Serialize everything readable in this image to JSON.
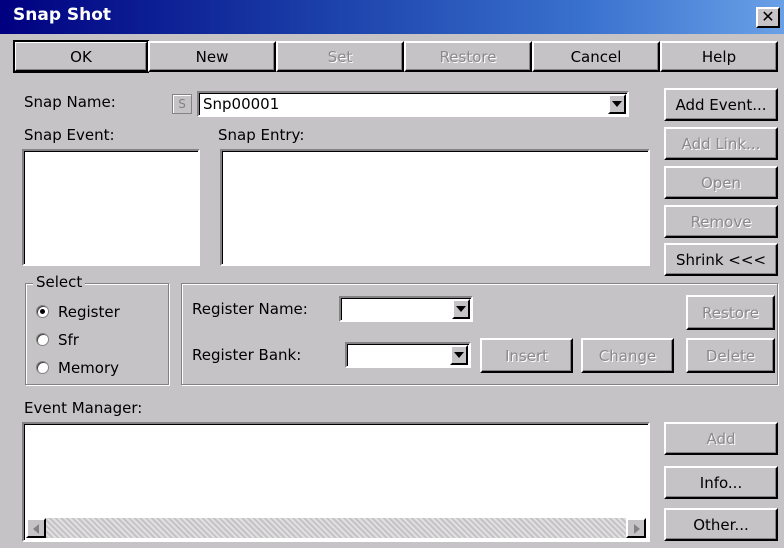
{
  "window": {
    "title": "Snap Shot",
    "close_glyph": "✕"
  },
  "toolbar": {
    "ok": "OK",
    "new": "New",
    "set": "Set",
    "restore": "Restore",
    "cancel": "Cancel",
    "help": "Help"
  },
  "snap": {
    "name_label": "Snap Name:",
    "name_value": "Snp00001",
    "s_glyph": "S",
    "event_label": "Snap Event:",
    "entry_label": "Snap Entry:"
  },
  "side_buttons": {
    "add_event": "Add Event...",
    "add_link": "Add Link...",
    "open": "Open",
    "remove": "Remove",
    "shrink": "Shrink <<<"
  },
  "select_group": {
    "legend": "Select",
    "options": [
      "Register",
      "Sfr",
      "Memory"
    ],
    "selected": "Register"
  },
  "register": {
    "name_label": "Register Name:",
    "bank_label": "Register Bank:",
    "name_value": "",
    "bank_value": "",
    "insert": "Insert",
    "change": "Change",
    "restore": "Restore",
    "delete": "Delete"
  },
  "event_manager": {
    "label": "Event Manager:",
    "add": "Add",
    "info": "Info...",
    "other": "Other..."
  }
}
